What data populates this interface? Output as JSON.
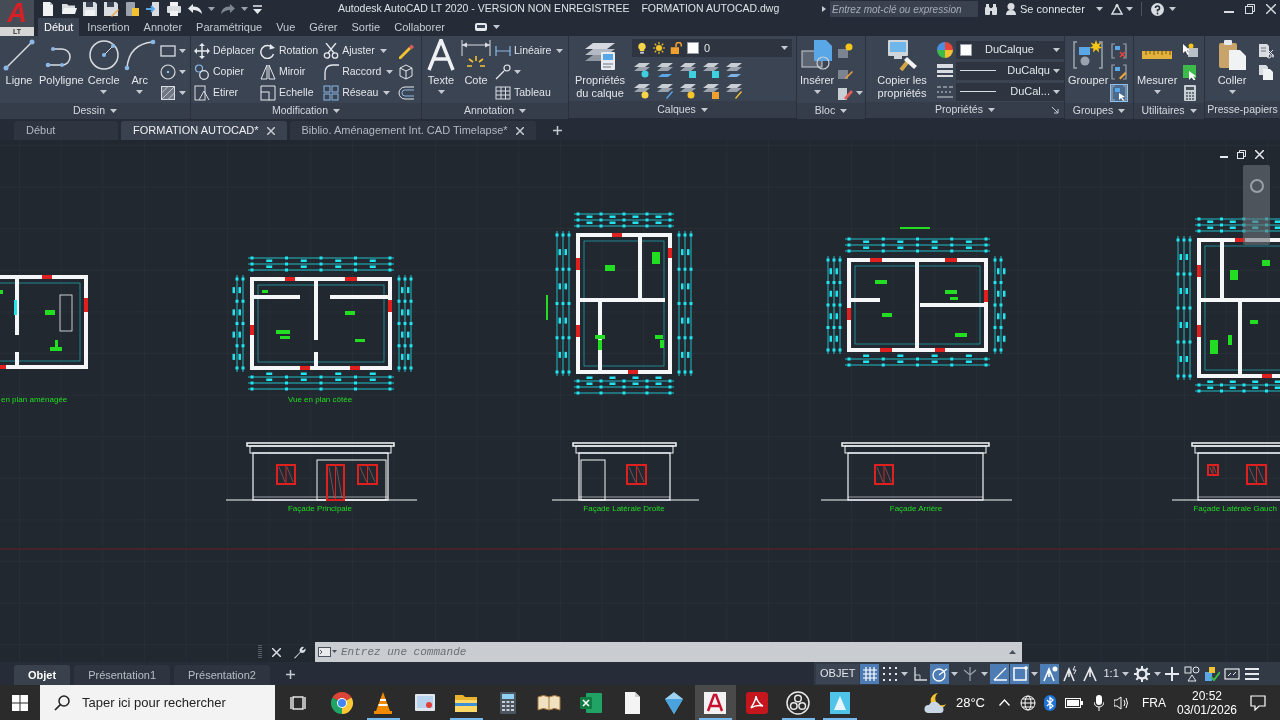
{
  "title_bar": {
    "logo_letter": "A",
    "edition": "LT",
    "title": "Autodesk AutoCAD LT 2020 - VERSION NON ENREGISTREE",
    "file_name": "FORMATION AUTOCAD.dwg",
    "search": {
      "placeholder": "Entrez mot-clé ou expression"
    },
    "sign_in": "Se connecter"
  },
  "ribbon": {
    "tabs": [
      {
        "label": "Début",
        "selected": true
      },
      {
        "label": "Insertion",
        "selected": false
      },
      {
        "label": "Annoter",
        "selected": false
      },
      {
        "label": "Paramétrique",
        "selected": false
      },
      {
        "label": "Vue",
        "selected": false
      },
      {
        "label": "Gérer",
        "selected": false
      },
      {
        "label": "Sortie",
        "selected": false
      },
      {
        "label": "Collaborer",
        "selected": false
      }
    ],
    "panels": [
      {
        "title": "Dessin",
        "title_dropdown": true,
        "tools": [
          {
            "kind": "large",
            "label": "Ligne",
            "dropdown": false
          },
          {
            "kind": "large",
            "label": "Polyligne",
            "dropdown": false
          },
          {
            "kind": "large",
            "label": "Cercle",
            "dropdown": true
          },
          {
            "kind": "large",
            "label": "Arc",
            "dropdown": true
          }
        ]
      },
      {
        "title": "Modification",
        "title_dropdown": true,
        "tools": [
          {
            "kind": "small",
            "label": "Déplacer",
            "dropdown": false
          },
          {
            "kind": "small",
            "label": "Copier",
            "dropdown": false
          },
          {
            "kind": "small",
            "label": "Etirer",
            "dropdown": false
          },
          {
            "kind": "small",
            "label": "Rotation",
            "dropdown": false
          },
          {
            "kind": "small",
            "label": "Miroir",
            "dropdown": false
          },
          {
            "kind": "small",
            "label": "Echelle",
            "dropdown": false
          },
          {
            "kind": "small",
            "label": "Ajuster",
            "dropdown": true
          },
          {
            "kind": "small",
            "label": "Raccord",
            "dropdown": true
          },
          {
            "kind": "small",
            "label": "Réseau",
            "dropdown": true
          }
        ]
      },
      {
        "title": "Annotation",
        "title_dropdown": true,
        "tools": [
          {
            "kind": "large",
            "label": "Texte",
            "dropdown": true
          },
          {
            "kind": "large",
            "label": "Cote",
            "dropdown": false
          },
          {
            "kind": "small",
            "label": "Linéaire",
            "dropdown": true
          },
          {
            "kind": "small",
            "label": "Tableau",
            "dropdown": false
          }
        ]
      },
      {
        "title": "Calques",
        "title_dropdown": true,
        "tools": [
          {
            "kind": "large",
            "label": "Propriétés du calque",
            "dropdown": false
          }
        ],
        "current_layer": "0"
      },
      {
        "title": "Bloc",
        "title_dropdown": true,
        "tools": [
          {
            "kind": "large",
            "label": "Insérer",
            "dropdown": true
          }
        ]
      },
      {
        "title": "Propriétés",
        "title_dropdown": true,
        "tools": [
          {
            "kind": "large",
            "label": "Copier les propriétés",
            "dropdown": false
          }
        ],
        "selectors": [
          {
            "kind": "color",
            "value": "DuCalque"
          },
          {
            "kind": "lineweight",
            "value": "DuCalqu"
          },
          {
            "kind": "linetype",
            "value": "DuCal..."
          }
        ]
      },
      {
        "title": "Groupes",
        "title_dropdown": true,
        "tools": [
          {
            "kind": "large",
            "label": "Grouper",
            "dropdown": false
          }
        ],
        "toggles": [
          {
            "on": false
          },
          {
            "on": false
          },
          {
            "on": true
          }
        ]
      },
      {
        "title": "Utilitaires",
        "title_dropdown": true,
        "tools": [
          {
            "kind": "large",
            "label": "Mesurer",
            "dropdown": true
          }
        ]
      },
      {
        "title": "Presse-papiers",
        "title_dropdown": false,
        "tools": [
          {
            "kind": "large",
            "label": "Coller",
            "dropdown": true
          }
        ]
      }
    ]
  },
  "file_tabs": [
    {
      "label": "Début",
      "selected": false,
      "closable": false
    },
    {
      "label": "FORMATION AUTOCAD*",
      "selected": true,
      "closable": true
    },
    {
      "label": "Biblio. Aménagement Int. CAD Timelapse*",
      "selected": false,
      "closable": true
    }
  ],
  "drawing": {
    "plan_captions": [
      "en plan aménagée",
      "Vue en plan côtée"
    ],
    "elevation_captions": [
      "Façade Principale",
      "Façade Latérale Droite",
      "Façade Arrière",
      "Façade Latérale Gauch"
    ]
  },
  "command_line": {
    "placeholder": "Entrez une commande"
  },
  "layout_tabs": [
    {
      "label": "Objet",
      "selected": true
    },
    {
      "label": "Présentation1",
      "selected": false
    },
    {
      "label": "Présentation2",
      "selected": false
    }
  ],
  "status_bar": {
    "items": [
      {
        "kind": "label",
        "label": "OBJET"
      },
      {
        "kind": "toggle",
        "on": true,
        "dropdown": false
      },
      {
        "kind": "toggle",
        "on": false,
        "dropdown": true
      },
      {
        "kind": "toggle",
        "on": false,
        "dropdown": false
      },
      {
        "kind": "toggle",
        "on": true,
        "dropdown": true
      },
      {
        "kind": "toggle",
        "on": false,
        "dropdown": true
      },
      {
        "kind": "toggle",
        "on": true,
        "dropdown": false
      },
      {
        "kind": "toggle",
        "on": true,
        "dropdown": true
      },
      {
        "kind": "toggle",
        "on": true,
        "dropdown": false
      },
      {
        "kind": "toggle",
        "on": false,
        "dropdown": false
      },
      {
        "kind": "toggle",
        "on": false,
        "dropdown": false
      },
      {
        "kind": "scale",
        "label": "1:1",
        "dropdown": true
      },
      {
        "kind": "button",
        "dropdown": true
      },
      {
        "kind": "button",
        "dropdown": false
      },
      {
        "kind": "button",
        "dropdown": false
      },
      {
        "kind": "button",
        "dropdown": false
      },
      {
        "kind": "button",
        "dropdown": false
      },
      {
        "kind": "button",
        "dropdown": false
      }
    ]
  },
  "taskbar": {
    "search": {
      "placeholder": "Taper ici pour rechercher"
    },
    "apps": [
      {
        "running": false,
        "selected": false
      },
      {
        "running": true,
        "selected": false
      },
      {
        "running": false,
        "selected": false
      },
      {
        "running": true,
        "selected": false
      },
      {
        "running": false,
        "selected": false
      },
      {
        "running": false,
        "selected": false
      },
      {
        "running": false,
        "selected": false
      },
      {
        "running": false,
        "selected": false
      },
      {
        "running": false,
        "selected": false
      },
      {
        "running": true,
        "selected": true
      },
      {
        "running": false,
        "selected": false
      },
      {
        "running": true,
        "selected": false
      },
      {
        "running": true,
        "selected": false
      }
    ],
    "temperature": "28°C",
    "language": "FRA",
    "time": "20:52",
    "date": "03/01/2026"
  }
}
